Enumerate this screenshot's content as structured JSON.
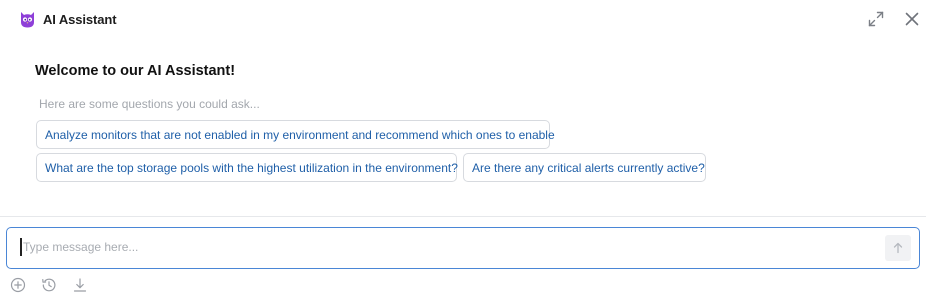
{
  "header": {
    "title": "AI Assistant",
    "logo_icon": "owl-logo-icon",
    "expand_icon": "expand-icon",
    "close_icon": "close-icon",
    "accent_color": "#8e3fd8"
  },
  "main": {
    "welcome": "Welcome to our AI Assistant!",
    "hint": "Here are some questions you could ask...",
    "suggestions": [
      "Analyze monitors that are not enabled in my environment and recommend which ones to enable",
      "What are the top storage pools with the highest utilization in the environment?",
      "Are there any critical alerts currently active?"
    ],
    "link_color": "#1f5fa8"
  },
  "composer": {
    "placeholder": "Type message here...",
    "value": "",
    "send_icon": "arrow-up-icon",
    "focus_color": "#4a86d6"
  },
  "footer_tools": {
    "new_chat_icon": "plus-circle-icon",
    "history_icon": "history-icon",
    "download_icon": "download-icon"
  }
}
